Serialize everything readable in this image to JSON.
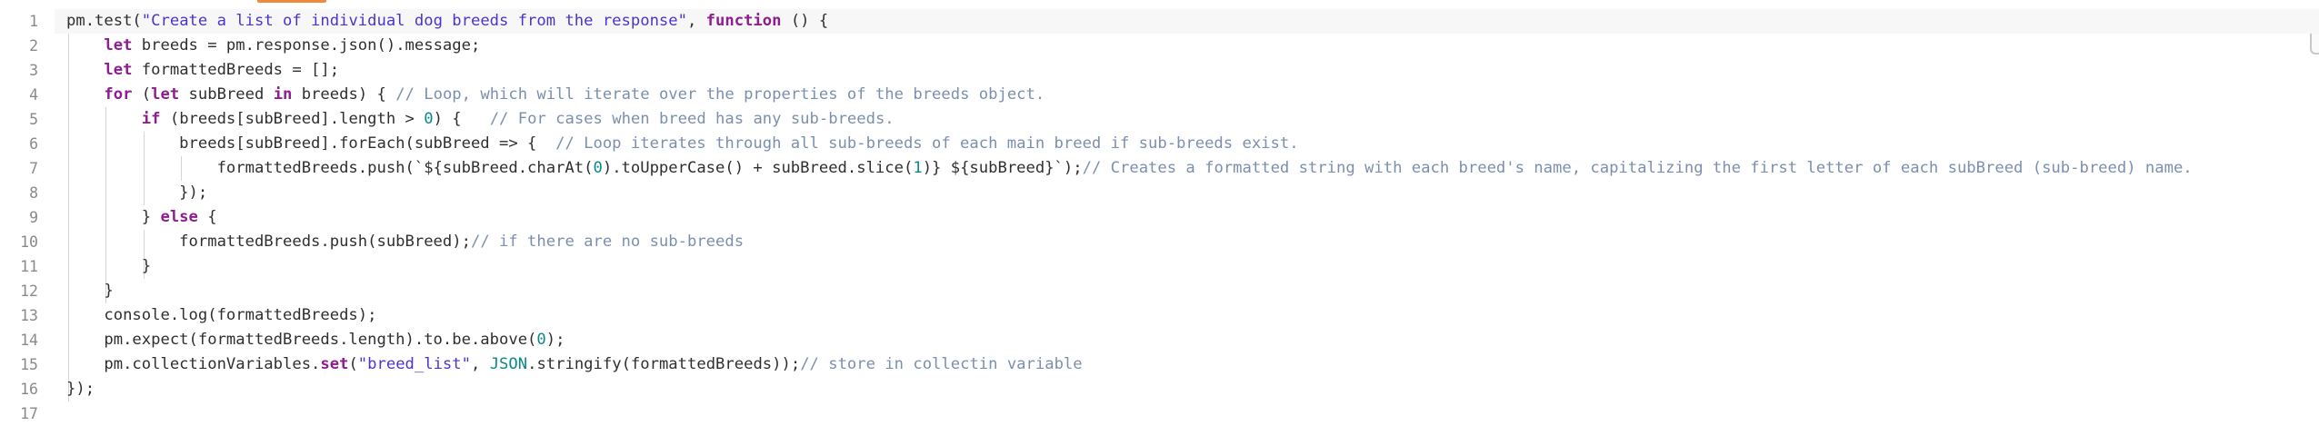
{
  "editor": {
    "lines": [
      {
        "n": "1",
        "t": [
          [
            "pm.test(",
            "p"
          ],
          [
            "\"Create a list of individual dog breeds from the response\"",
            "str"
          ],
          [
            ", ",
            "p"
          ],
          [
            "function",
            "kw"
          ],
          [
            " () {",
            "p"
          ]
        ]
      },
      {
        "n": "2",
        "t": [
          [
            "    ",
            "p"
          ],
          [
            "let",
            "kw"
          ],
          [
            " breeds = pm.response.json().message;",
            "p"
          ]
        ]
      },
      {
        "n": "3",
        "t": [
          [
            "    ",
            "p"
          ],
          [
            "let",
            "kw"
          ],
          [
            " formattedBreeds = [];",
            "p"
          ]
        ]
      },
      {
        "n": "4",
        "t": [
          [
            "    ",
            "p"
          ],
          [
            "for",
            "kw"
          ],
          [
            " (",
            "p"
          ],
          [
            "let",
            "kw"
          ],
          [
            " subBreed ",
            "p"
          ],
          [
            "in",
            "kw"
          ],
          [
            " breeds) { ",
            "p"
          ],
          [
            "// Loop, which will iterate over the properties of the breeds object.",
            "com"
          ]
        ]
      },
      {
        "n": "5",
        "t": [
          [
            "        ",
            "p"
          ],
          [
            "if",
            "kw"
          ],
          [
            " (breeds[subBreed].length > ",
            "p"
          ],
          [
            "0",
            "num"
          ],
          [
            ") {   ",
            "p"
          ],
          [
            "// For cases when breed has any sub-breeds.",
            "com"
          ]
        ]
      },
      {
        "n": "6",
        "t": [
          [
            "            breeds[subBreed].forEach(subBreed => {  ",
            "p"
          ],
          [
            "// Loop iterates through all sub-breeds of each main breed if sub-breeds exist.",
            "com"
          ]
        ]
      },
      {
        "n": "7",
        "t": [
          [
            "                formattedBreeds.push(`${subBreed.charAt(",
            "p"
          ],
          [
            "0",
            "num"
          ],
          [
            ").toUpperCase() + subBreed.slice(",
            "p"
          ],
          [
            "1",
            "num"
          ],
          [
            ")} ${subBreed}`);",
            "p"
          ],
          [
            "// Creates a formatted string with each breed's name, capitalizing the first letter of each subBreed (sub-breed) name.",
            "com"
          ]
        ]
      },
      {
        "n": "8",
        "t": [
          [
            "            });",
            "p"
          ]
        ]
      },
      {
        "n": "9",
        "t": [
          [
            "        } ",
            "p"
          ],
          [
            "else",
            "kw"
          ],
          [
            " {",
            "p"
          ]
        ]
      },
      {
        "n": "10",
        "t": [
          [
            "            formattedBreeds.push(subBreed);",
            "p"
          ],
          [
            "// if there are no sub-breeds",
            "com"
          ]
        ]
      },
      {
        "n": "11",
        "t": [
          [
            "        }",
            "p"
          ]
        ]
      },
      {
        "n": "12",
        "t": [
          [
            "    }",
            "p"
          ]
        ]
      },
      {
        "n": "13",
        "t": [
          [
            "    console.log(formattedBreeds);",
            "p"
          ]
        ]
      },
      {
        "n": "14",
        "t": [
          [
            "    pm.expect(formattedBreeds.length).to.be.above(",
            "p"
          ],
          [
            "0",
            "num"
          ],
          [
            ");",
            "p"
          ]
        ]
      },
      {
        "n": "15",
        "t": [
          [
            "    pm.collectionVariables.",
            "p"
          ],
          [
            "set",
            "kw"
          ],
          [
            "(",
            "p"
          ],
          [
            "\"breed_list\"",
            "str"
          ],
          [
            ", ",
            "p"
          ],
          [
            "JSON",
            "num"
          ],
          [
            ".stringify(formattedBreeds));",
            "p"
          ],
          [
            "// store in collectin variable",
            "com"
          ]
        ]
      },
      {
        "n": "16",
        "t": [
          [
            "});",
            "p"
          ]
        ]
      },
      {
        "n": "17",
        "t": []
      }
    ]
  },
  "colors": {
    "keyword": "#8e1e8e",
    "string": "#4a36c9",
    "number": "#0a8a8a",
    "comment": "#7c8fae",
    "text": "#2f2f2f",
    "line_number": "#8a8a8a",
    "top_marker": "#f08a3c"
  }
}
